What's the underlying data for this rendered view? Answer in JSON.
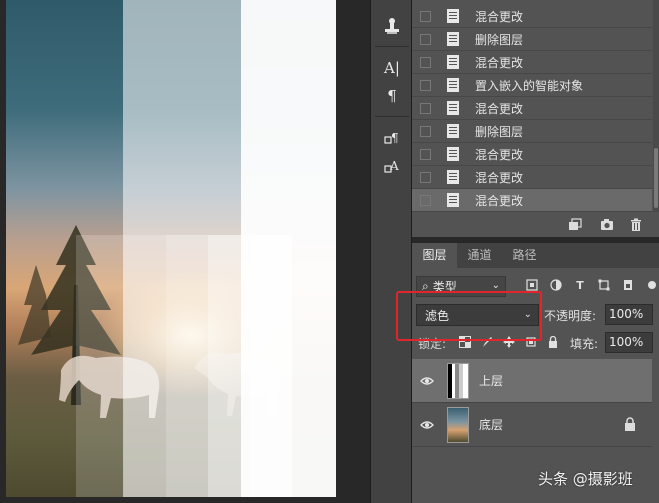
{
  "history": {
    "items": [
      {
        "label": "混合更改",
        "active": false
      },
      {
        "label": "删除图层",
        "active": false
      },
      {
        "label": "混合更改",
        "active": false
      },
      {
        "label": "置入嵌入的智能对象",
        "active": false
      },
      {
        "label": "混合更改",
        "active": false
      },
      {
        "label": "删除图层",
        "active": false
      },
      {
        "label": "混合更改",
        "active": false
      },
      {
        "label": "混合更改",
        "active": false
      },
      {
        "label": "混合更改",
        "active": true
      }
    ],
    "footer_icons": [
      "new-snapshot-icon",
      "camera-icon",
      "trash-icon"
    ]
  },
  "toolbar": {
    "tools": [
      "stamp-icon",
      "type-tool-icon",
      "paragraph-icon",
      "paragraph-style-icon",
      "character-style-icon"
    ],
    "type_glyph": "A|",
    "para_glyph": "¶",
    "char_glyph": "A"
  },
  "layers_panel": {
    "tabs": [
      "图层",
      "通道",
      "路径"
    ],
    "active_tab": "图层",
    "filter": {
      "label": "类型",
      "prefix": "⌕"
    },
    "blend_mode": "滤色",
    "opacity_label": "不透明度:",
    "opacity_value": "100%",
    "lock_label": "锁定:",
    "fill_label": "填充:",
    "fill_value": "100%",
    "layers": [
      {
        "name": "上层",
        "selected": true,
        "locked": false
      },
      {
        "name": "底层",
        "selected": false,
        "locked": true
      }
    ]
  },
  "watermark": "头条 @摄影班",
  "colors": {
    "highlight": "#e0262a",
    "panel_bg": "#535353",
    "toolbar_bg": "#424242"
  }
}
